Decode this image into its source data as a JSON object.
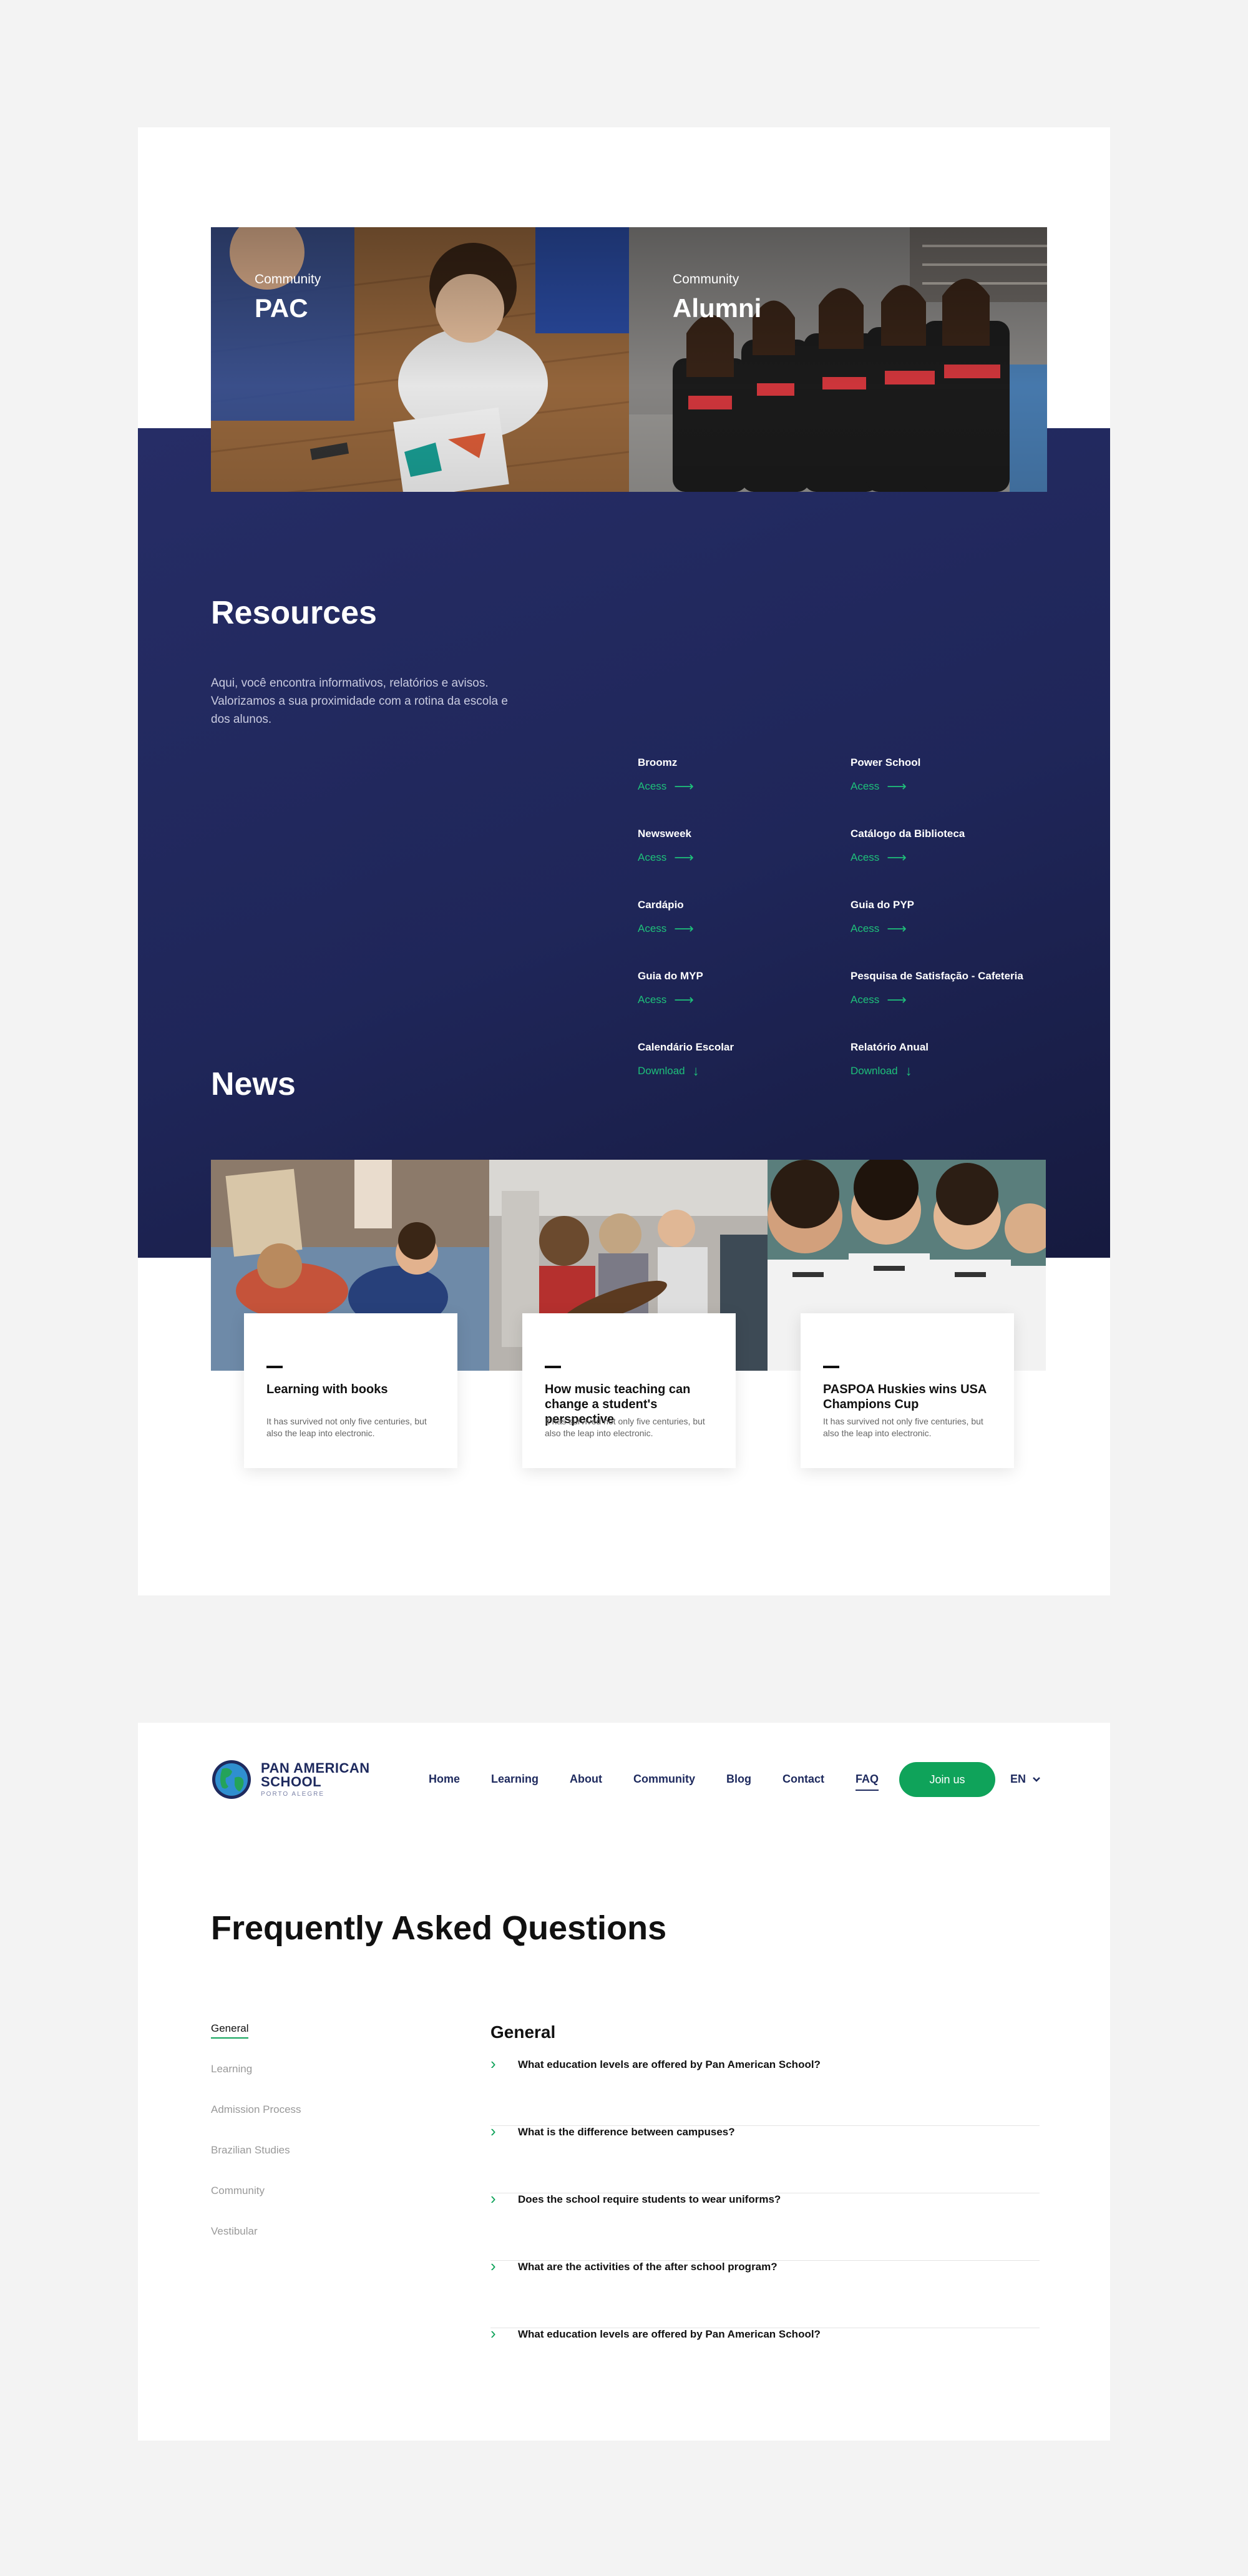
{
  "community": [
    {
      "kicker": "Community",
      "title": "PAC"
    },
    {
      "kicker": "Community",
      "title": "Alumni"
    }
  ],
  "resources": {
    "title": "Resources",
    "description": "Aqui, você encontra informativos, relatórios e avisos. Valorizamos a sua proximidade com a rotina da escola e dos alunos.",
    "items": [
      {
        "name": "Broomz",
        "action": "Acess",
        "icon": "arrow-right-icon"
      },
      {
        "name": "Power School",
        "action": "Acess",
        "icon": "arrow-right-icon"
      },
      {
        "name": "Newsweek",
        "action": "Acess",
        "icon": "arrow-right-icon"
      },
      {
        "name": "Catálogo da Biblioteca",
        "action": "Acess",
        "icon": "arrow-right-icon"
      },
      {
        "name": "Cardápio",
        "action": "Acess",
        "icon": "arrow-right-icon"
      },
      {
        "name": "Guia do PYP",
        "action": "Acess",
        "icon": "arrow-right-icon"
      },
      {
        "name": "Guia do MYP",
        "action": "Acess",
        "icon": "arrow-right-icon"
      },
      {
        "name": "Pesquisa de Satisfação - Cafeteria",
        "action": "Acess",
        "icon": "arrow-right-icon"
      },
      {
        "name": "Calendário Escolar",
        "action": "Download",
        "icon": "arrow-down-icon"
      },
      {
        "name": "Relatório Anual",
        "action": "Download",
        "icon": "arrow-down-icon"
      }
    ]
  },
  "news": {
    "title": "News",
    "items": [
      {
        "title": "Learning with books",
        "text": "It has survived not only five centuries, but also the leap into electronic."
      },
      {
        "title": "How music teaching can change a student's perspective",
        "text": "It has survived not only five centuries, but also the leap into electronic."
      },
      {
        "title": "PASPOA Huskies wins USA Champions Cup",
        "text": "It has survived not only five centuries, but also the leap into electronic."
      }
    ]
  },
  "header": {
    "logo_line1": "PAN AMERICAN",
    "logo_line2": "SCHOOL",
    "logo_line3": "PORTO ALEGRE",
    "nav": [
      "Home",
      "Learning",
      "About",
      "Community",
      "Blog",
      "Contact",
      "FAQ"
    ],
    "active_nav": "FAQ",
    "join_label": "Join us",
    "language": "EN"
  },
  "faq": {
    "title": "Frequently Asked Questions",
    "categories": [
      "General",
      "Learning",
      "Admission Process",
      "Brazilian Studies",
      "Community",
      "Vestibular"
    ],
    "active_category": "General",
    "section_title": "General",
    "questions": [
      "What education levels are offered by Pan American School?",
      "What is the difference between campuses?",
      "Does the school require students to wear uniforms?",
      "What are the activities of the after school program?",
      "What education levels are offered by Pan American School?"
    ]
  },
  "colors": {
    "navy": "#1f2659",
    "accent_green": "#1ec07a",
    "button_green": "#0fa35a",
    "brand_blue": "#1e2a5e"
  }
}
